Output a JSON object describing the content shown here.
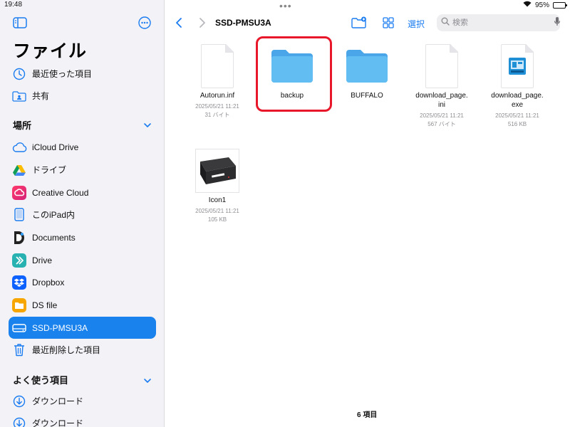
{
  "status_bar": {
    "time": "19:48",
    "battery": "95%",
    "battery_level": 0.95
  },
  "sidebar": {
    "title": "ファイル",
    "top_items": [
      {
        "label": "最近使った項目",
        "icon": "clock-icon"
      },
      {
        "label": "共有",
        "icon": "shared-folder-icon"
      }
    ],
    "locations_header": "場所",
    "locations": [
      {
        "label": "iCloud Drive",
        "icon": "icloud-icon"
      },
      {
        "label": "ドライブ",
        "icon": "google-drive-icon"
      },
      {
        "label": "Creative Cloud",
        "icon": "creative-cloud-icon"
      },
      {
        "label": "このiPad内",
        "icon": "ipad-icon"
      },
      {
        "label": "Documents",
        "icon": "documents-app-icon"
      },
      {
        "label": "Drive",
        "icon": "drive-app-icon"
      },
      {
        "label": "Dropbox",
        "icon": "dropbox-icon"
      },
      {
        "label": "DS file",
        "icon": "ds-file-icon"
      },
      {
        "label": "SSD-PMSU3A",
        "icon": "external-drive-icon",
        "selected": true
      },
      {
        "label": "最近削除した項目",
        "icon": "trash-icon"
      }
    ],
    "favorites_header": "よく使う項目",
    "favorites": [
      {
        "label": "ダウンロード",
        "icon": "download-icon"
      },
      {
        "label": "ダウンロード",
        "icon": "download-icon"
      }
    ]
  },
  "toolbar": {
    "title": "SSD-PMSU3A",
    "select_label": "選択",
    "search_placeholder": "検索"
  },
  "files": [
    {
      "name": "Autorun.inf",
      "date": "2025/05/21 11:21",
      "size": "31 バイト",
      "type": "document"
    },
    {
      "name": "backup",
      "date": "",
      "size": "",
      "type": "folder",
      "highlighted": true
    },
    {
      "name": "BUFFALO",
      "date": "",
      "size": "",
      "type": "folder"
    },
    {
      "name": "download_page.\nini",
      "date": "2025/05/21 11:21",
      "size": "567 バイト",
      "type": "document"
    },
    {
      "name": "download_page.\nexe",
      "date": "2025/05/21 11:21",
      "size": "516 KB",
      "type": "exe"
    },
    {
      "name": "Icon1",
      "date": "2025/05/21 11:21",
      "size": "105 KB",
      "type": "image"
    }
  ],
  "footer": {
    "item_count": "6 項目"
  },
  "colors": {
    "accent": "#1a82ec",
    "folder": "#5ab4f0",
    "highlight": "#e8182a"
  }
}
